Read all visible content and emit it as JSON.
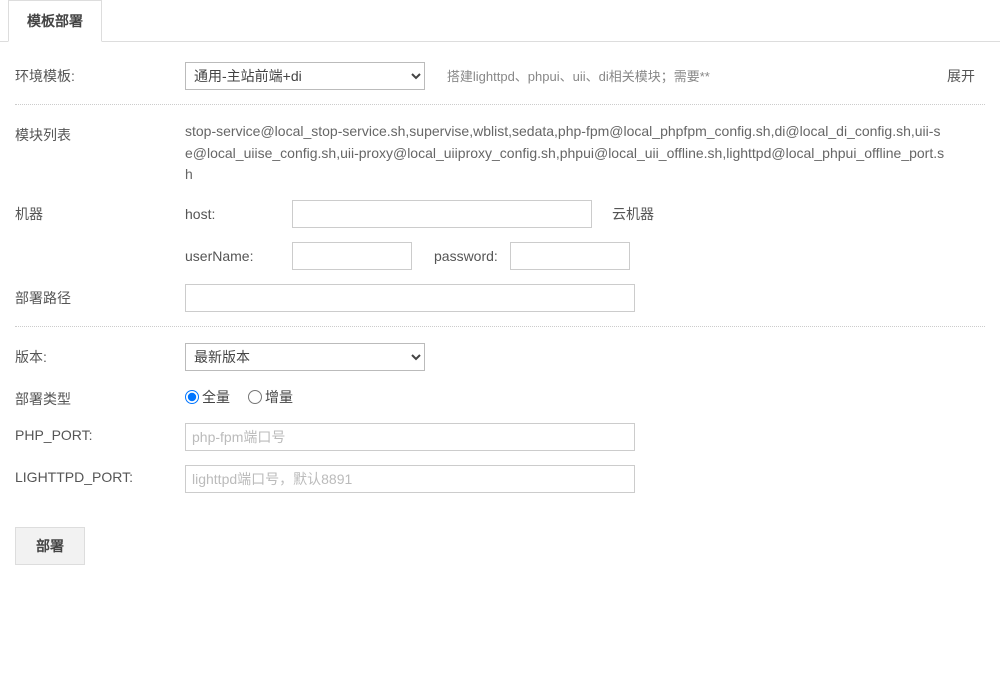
{
  "tab": {
    "title": "模板部署"
  },
  "env_template": {
    "label": "环境模板:",
    "selected": "通用-主站前端+di",
    "hint": "搭建lighttpd、phpui、uii、di相关模块；需要**",
    "expand": "展开"
  },
  "module_list": {
    "label": "模块列表",
    "value": "stop-service@local_stop-service.sh,supervise,wblist,sedata,php-fpm@local_phpfpm_config.sh,di@local_di_config.sh,uii-se@local_uiise_config.sh,uii-proxy@local_uiiproxy_config.sh,phpui@local_uii_offline.sh,lighttpd@local_phpui_offline_port.sh"
  },
  "machine": {
    "label": "机器",
    "host_label": "host:",
    "cloud_label": "云机器",
    "username_label": "userName:",
    "password_label": "password:"
  },
  "deploy_path": {
    "label": "部署路径"
  },
  "version": {
    "label": "版本:",
    "selected": "最新版本"
  },
  "deploy_type": {
    "label": "部署类型",
    "full": "全量",
    "incremental": "增量"
  },
  "php_port": {
    "label": "PHP_PORT:",
    "placeholder": "php-fpm端口号"
  },
  "lighttpd_port": {
    "label": "LIGHTTPD_PORT:",
    "placeholder": "lighttpd端口号，默认8891"
  },
  "submit": {
    "label": "部署"
  }
}
